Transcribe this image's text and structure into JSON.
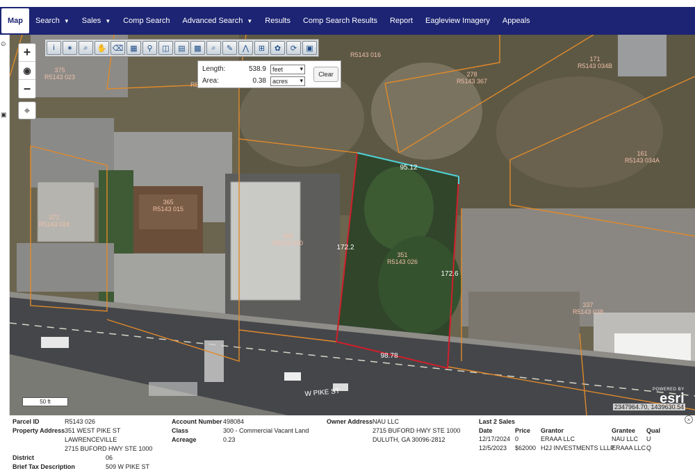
{
  "nav": {
    "items": [
      {
        "label": "Map",
        "active": true,
        "dropdown": false
      },
      {
        "label": "Search",
        "dropdown": true
      },
      {
        "label": "Sales",
        "dropdown": true
      },
      {
        "label": "Comp Search",
        "dropdown": false
      },
      {
        "label": "Advanced Search",
        "dropdown": true
      },
      {
        "label": "Results",
        "dropdown": false
      },
      {
        "label": "Comp Search Results",
        "dropdown": false
      },
      {
        "label": "Report",
        "dropdown": false
      },
      {
        "label": "Eagleview Imagery",
        "dropdown": false
      },
      {
        "label": "Appeals",
        "dropdown": false
      }
    ],
    "background": "#1c2473"
  },
  "map_controls": {
    "zoom_in": "+",
    "zoom_out": "−",
    "globe_icon": "globe-icon",
    "locate_icon": "crosshair-icon"
  },
  "toolbar": {
    "tools": [
      "info-icon",
      "identify-icon",
      "zoom-select-icon",
      "pan-icon",
      "erase-icon",
      "select-icon",
      "pin-icon",
      "layers-icon",
      "table-icon",
      "measure-icon",
      "search-icon",
      "draw-icon",
      "node-icon",
      "buffer-icon",
      "locate-parcel-icon",
      "refresh-icon",
      "save-icon"
    ]
  },
  "measure": {
    "length_label": "Length:",
    "length_value": "538.9",
    "length_unit": "feet",
    "area_label": "Area:",
    "area_value": "0.38",
    "area_unit": "acres",
    "clear_label": "Clear"
  },
  "map_labels": {
    "dimensions": [
      "95.12",
      "172.2",
      "172.6",
      "98.78"
    ],
    "street": "W PIKE ST",
    "parcels": [
      {
        "addr": "371",
        "id": "R5143 024"
      },
      {
        "addr": "365",
        "id": "R5143 015"
      },
      {
        "addr": "359",
        "id": "R5143 030"
      },
      {
        "addr": "351",
        "id": "R5143 026"
      },
      {
        "addr": "278",
        "id": "R5143 367"
      },
      {
        "addr": "171",
        "id": "R5143 034B"
      },
      {
        "addr": "161",
        "id": "R5143 034A"
      },
      {
        "addr": "337",
        "id": "R5143 038"
      },
      {
        "addr": "",
        "id": "R5143 016"
      },
      {
        "addr": "",
        "id": "R5143 017"
      },
      {
        "addr": "375",
        "id": "R5143 023"
      }
    ]
  },
  "scalebar": "50 ft",
  "coordinates": "2347964.70, 1439630.54",
  "esri": {
    "powered_by": "POWERED BY",
    "logo": "esri"
  },
  "parcel": {
    "parcel_id_label": "Parcel ID",
    "parcel_id": "R5143 026",
    "property_address_label": "Property Address",
    "property_address": [
      "351 WEST PIKE ST",
      "LAWRENCEVILLE",
      "2715 BUFORD HWY STE 1000"
    ],
    "district_label": "District",
    "district": "06",
    "brief_tax_label": "Brief Tax Description",
    "brief_tax": "509 W PIKE ST",
    "account_number_label": "Account Number",
    "account_number": "498084",
    "class_label": "Class",
    "class": "300 - Commercial Vacant Land",
    "acreage_label": "Acreage",
    "acreage": "0.23",
    "owner_address_label": "Owner Address",
    "owner_address": [
      "NAU LLC",
      "2715 BUFORD HWY STE 1000",
      "DULUTH, GA 30096-2812"
    ]
  },
  "sales": {
    "title": "Last 2 Sales",
    "columns": [
      "Date",
      "Price",
      "Grantor",
      "Grantee",
      "Qual"
    ],
    "rows": [
      [
        "12/17/2024",
        "0",
        "ERAAA LLC",
        "NAU LLC",
        "U"
      ],
      [
        "12/5/2023",
        "$62000",
        "H2J INVESTMENTS LLLP",
        "ERAAA LLC",
        "Q"
      ]
    ]
  },
  "colors": {
    "parcel_line": "#e08a2a",
    "parcel_label": "#f0c0a8",
    "selected_parcel": "#d01f2a",
    "measure_segment": "#4fd2d8"
  }
}
